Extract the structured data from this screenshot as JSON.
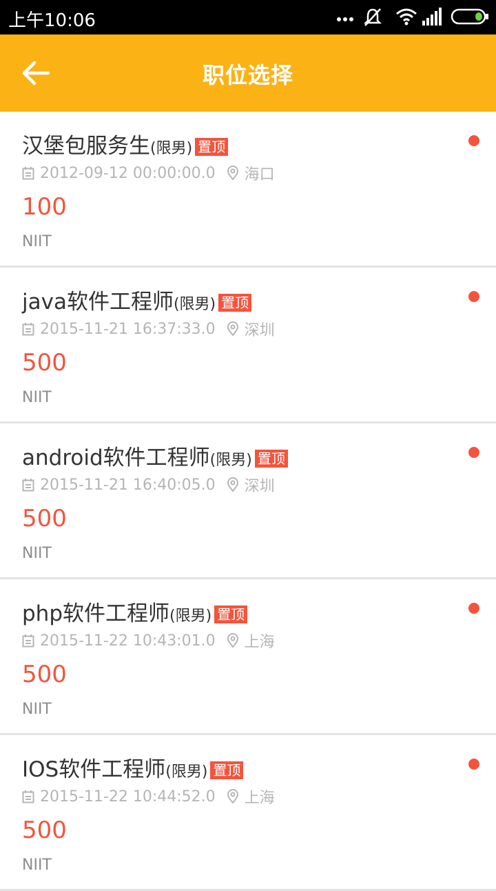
{
  "status_bar": {
    "time": "上午10:06"
  },
  "header": {
    "title": "职位选择",
    "back_icon": "back-arrow-icon"
  },
  "colors": {
    "accent": "#fbb215",
    "highlight": "#f4543c"
  },
  "jobs": [
    {
      "title": "汉堡包服务生",
      "gender": "(限男)",
      "badge": "置顶",
      "date": "2012-09-12 00:00:00.0",
      "location": "海口",
      "salary": "100",
      "company": "NIIT"
    },
    {
      "title": "java软件工程师",
      "gender": "(限男)",
      "badge": "置顶",
      "date": "2015-11-21 16:37:33.0",
      "location": "深圳",
      "salary": "500",
      "company": "NIIT"
    },
    {
      "title": "android软件工程师",
      "gender": "(限男)",
      "badge": "置顶",
      "date": "2015-11-21 16:40:05.0",
      "location": "深圳",
      "salary": "500",
      "company": "NIIT"
    },
    {
      "title": "php软件工程师",
      "gender": "(限男)",
      "badge": "置顶",
      "date": "2015-11-22 10:43:01.0",
      "location": "上海",
      "salary": "500",
      "company": "NIIT"
    },
    {
      "title": "IOS软件工程师",
      "gender": "(限男)",
      "badge": "置顶",
      "date": "2015-11-22 10:44:52.0",
      "location": "上海",
      "salary": "500",
      "company": "NIIT"
    }
  ]
}
